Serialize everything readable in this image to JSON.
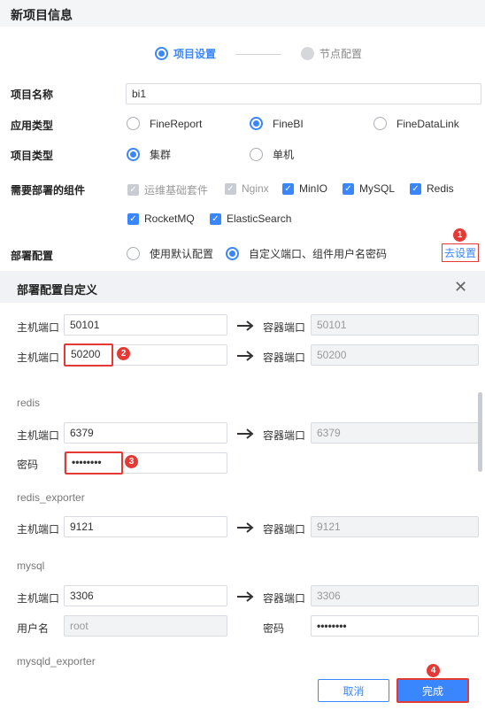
{
  "header": {
    "title": "新项目信息"
  },
  "steps": [
    {
      "label": "项目设置",
      "active": true
    },
    {
      "label": "节点配置",
      "active": false
    }
  ],
  "project_name": {
    "label": "项目名称",
    "value": "bi1"
  },
  "app_type": {
    "label": "应用类型",
    "options": [
      "FineReport",
      "FineBI",
      "FineDataLink"
    ],
    "selected": "FineBI"
  },
  "project_type": {
    "label": "项目类型",
    "options": [
      "集群",
      "单机"
    ],
    "selected": "集群"
  },
  "components": {
    "label": "需要部署的组件",
    "items": [
      {
        "name": "运维基础套件",
        "checked": true,
        "disabled": true
      },
      {
        "name": "Nginx",
        "checked": true,
        "disabled": true
      },
      {
        "name": "MinIO",
        "checked": true,
        "disabled": false
      },
      {
        "name": "MySQL",
        "checked": true,
        "disabled": false
      },
      {
        "name": "Redis",
        "checked": true,
        "disabled": false
      },
      {
        "name": "RocketMQ",
        "checked": true,
        "disabled": false
      },
      {
        "name": "ElasticSearch",
        "checked": true,
        "disabled": false
      }
    ]
  },
  "deploy": {
    "label": "部署配置",
    "options": [
      "使用默认配置",
      "自定义端口、组件用户名密码"
    ],
    "selected": "自定义端口、组件用户名密码",
    "link": "去设置"
  },
  "custom_panel": {
    "title": "部署配置自定义",
    "close_icon": "close-icon",
    "host_port_label": "主机端口",
    "container_port_label": "容器端口",
    "password_label": "密码",
    "username_label": "用户名",
    "ports_top": [
      {
        "host": "50101",
        "container": "50101"
      },
      {
        "host": "50200",
        "container": "50200"
      }
    ],
    "redis": {
      "title": "redis",
      "host": "6379",
      "container": "6379",
      "password": "••••••••"
    },
    "redis_exporter": {
      "title": "redis_exporter",
      "host": "9121",
      "container": "9121"
    },
    "mysql": {
      "title": "mysql",
      "host": "3306",
      "container": "3306",
      "username": "root",
      "password": "••••••••"
    },
    "mysqld_exporter": {
      "title": "mysqld_exporter"
    }
  },
  "badges": [
    "1",
    "2",
    "3",
    "4"
  ],
  "footer": {
    "cancel": "取消",
    "confirm": "完成"
  },
  "colors": {
    "accent": "#3a86ff",
    "highlight": "#e53935"
  }
}
